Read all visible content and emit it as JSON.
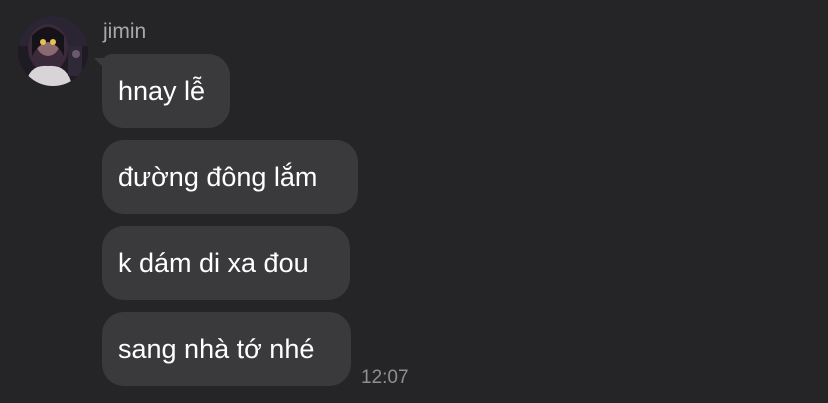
{
  "chat": {
    "sender_name": "jimin",
    "messages": [
      {
        "text": "hnay lễ"
      },
      {
        "text": "đường đông lắm"
      },
      {
        "text": "k dám di xa đou"
      },
      {
        "text": "sang nhà tớ nhé"
      }
    ],
    "timestamp": "12:07"
  },
  "colors": {
    "background": "#252527",
    "bubble": "#3a3a3c",
    "text": "#ffffff",
    "meta_text": "#8e8e93"
  },
  "icons": {
    "avatar": "avatar-photo"
  }
}
